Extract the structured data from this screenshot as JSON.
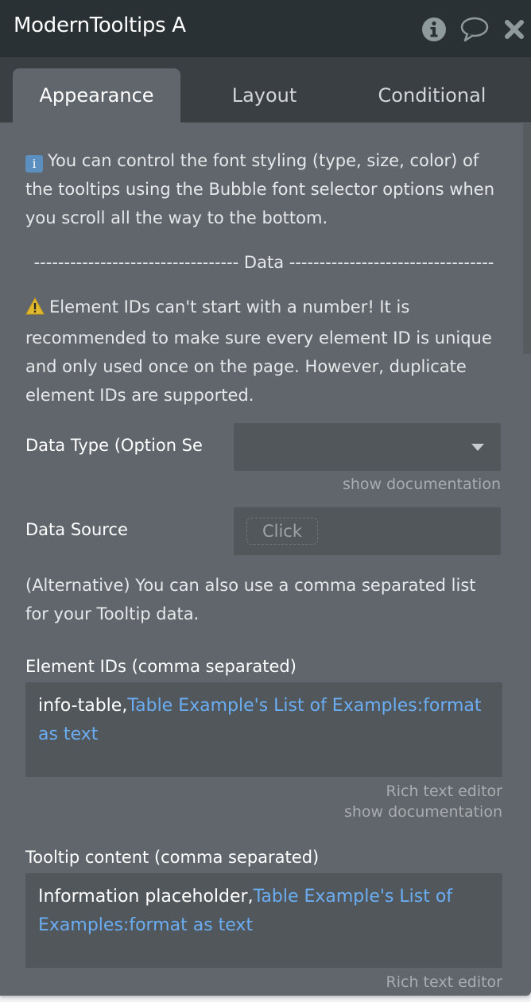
{
  "header": {
    "title": "ModernTooltips A",
    "icons": [
      "info-icon",
      "comment-icon",
      "close-icon"
    ]
  },
  "tabs": [
    {
      "label": "Appearance",
      "active": true
    },
    {
      "label": "Layout",
      "active": false
    },
    {
      "label": "Conditional",
      "active": false
    }
  ],
  "notes": {
    "info_icon_glyph": "i",
    "font_note": "You can control the font styling (type, size, color) of the tooltips using the Bubble font selector options when you scroll all the way to the bottom.",
    "separator": "---------------------------------- Data ----------------------------------",
    "warning_note": "Element IDs can't start with a number! It is recommended to make sure every element ID is unique and only used once on the page. However, duplicate element IDs are supported.",
    "alternative_note": "(Alternative) You can also use a comma separated list for your Tooltip data."
  },
  "fields": {
    "data_type": {
      "label": "Data Type (Option Se",
      "value": "",
      "helper": "show documentation"
    },
    "data_source": {
      "label": "Data Source",
      "button_label": "Click"
    },
    "element_ids": {
      "label": "Element IDs (comma separated)",
      "static_text": "info-table,",
      "dynamic_text": "Table Example's List of Examples:format as text",
      "helper_1": "Rich text editor",
      "helper_2": "show documentation"
    },
    "tooltip_content": {
      "label": "Tooltip content (comma separated)",
      "static_text": "Information placeholder,",
      "dynamic_text": "Table Example's List of Examples:format as text",
      "helper_1": "Rich text editor"
    }
  },
  "colors": {
    "header_bg": "#2a3134",
    "tabbar_bg": "#3a3f43",
    "panel_bg": "#60666b",
    "field_bg": "#52575b",
    "dynamic_text": "#6aadf2",
    "warning": "#e0b92e"
  }
}
